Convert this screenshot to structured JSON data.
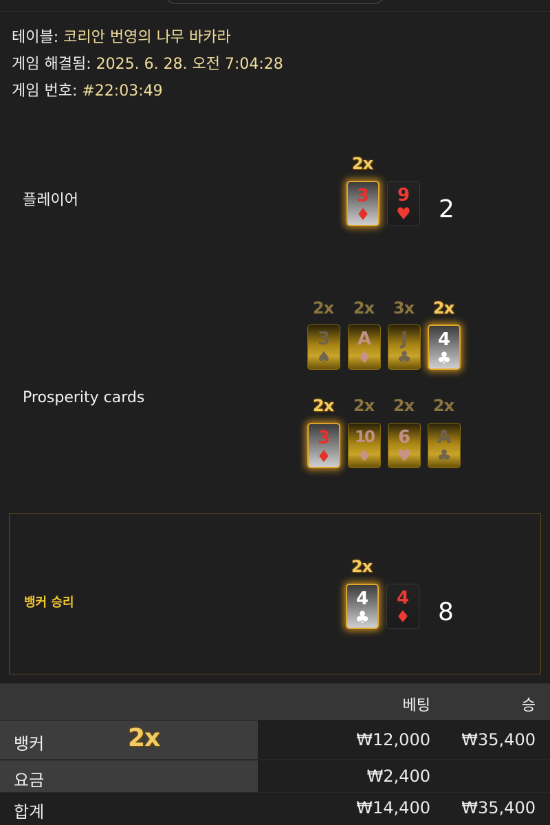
{
  "info": {
    "table_label": "테이블:",
    "table_name": "코리안 번영의 나무 바카라",
    "resolved_label": "게임 해결됨:",
    "resolved_value": "2025. 6. 28. 오전 7:04:28",
    "game_no_label": "게임 번호:",
    "game_no_value": "#22:03:49"
  },
  "player": {
    "label": "플레이어",
    "score": "2",
    "cards": [
      {
        "rank": "3",
        "suit": "♦",
        "multiplier": "2x",
        "lucky": true
      },
      {
        "rank": "9",
        "suit": "♥",
        "multiplier": "",
        "lucky": false
      }
    ]
  },
  "prosperity": {
    "label": "Prosperity cards",
    "row1": [
      {
        "rank": "3",
        "suit": "♠",
        "multiplier": "2x",
        "lucky": false
      },
      {
        "rank": "A",
        "suit": "♦",
        "multiplier": "2x",
        "lucky": false
      },
      {
        "rank": "J",
        "suit": "♣",
        "multiplier": "3x",
        "lucky": false
      },
      {
        "rank": "4",
        "suit": "♣",
        "multiplier": "2x",
        "lucky": true
      }
    ],
    "row2": [
      {
        "rank": "3",
        "suit": "♦",
        "multiplier": "2x",
        "lucky": true
      },
      {
        "rank": "10",
        "suit": "♦",
        "multiplier": "2x",
        "lucky": false
      },
      {
        "rank": "6",
        "suit": "♥",
        "multiplier": "2x",
        "lucky": false
      },
      {
        "rank": "A",
        "suit": "♣",
        "multiplier": "2x",
        "lucky": false
      }
    ]
  },
  "banker": {
    "result_label": "뱅커 승리",
    "score": "8",
    "cards": [
      {
        "rank": "4",
        "suit": "♣",
        "multiplier": "2x",
        "lucky": true
      },
      {
        "rank": "4",
        "suit": "♦",
        "multiplier": "",
        "lucky": false
      }
    ]
  },
  "table": {
    "headers": {
      "bet": "베팅",
      "win": "승"
    },
    "rows": [
      {
        "label": "뱅커",
        "multiplier": "2x",
        "bet": "₩12,000",
        "win": "₩35,400"
      },
      {
        "label": "요금",
        "multiplier": "",
        "bet": "₩2,400",
        "win": ""
      },
      {
        "label": "합계",
        "multiplier": "",
        "bet": "₩14,400",
        "win": "₩35,400"
      }
    ]
  },
  "colors": {
    "accent_gold": "#f3cb63",
    "winner_text": "#f2c731",
    "red_suit": "#ef3a33",
    "background": "#1f1f1f"
  }
}
